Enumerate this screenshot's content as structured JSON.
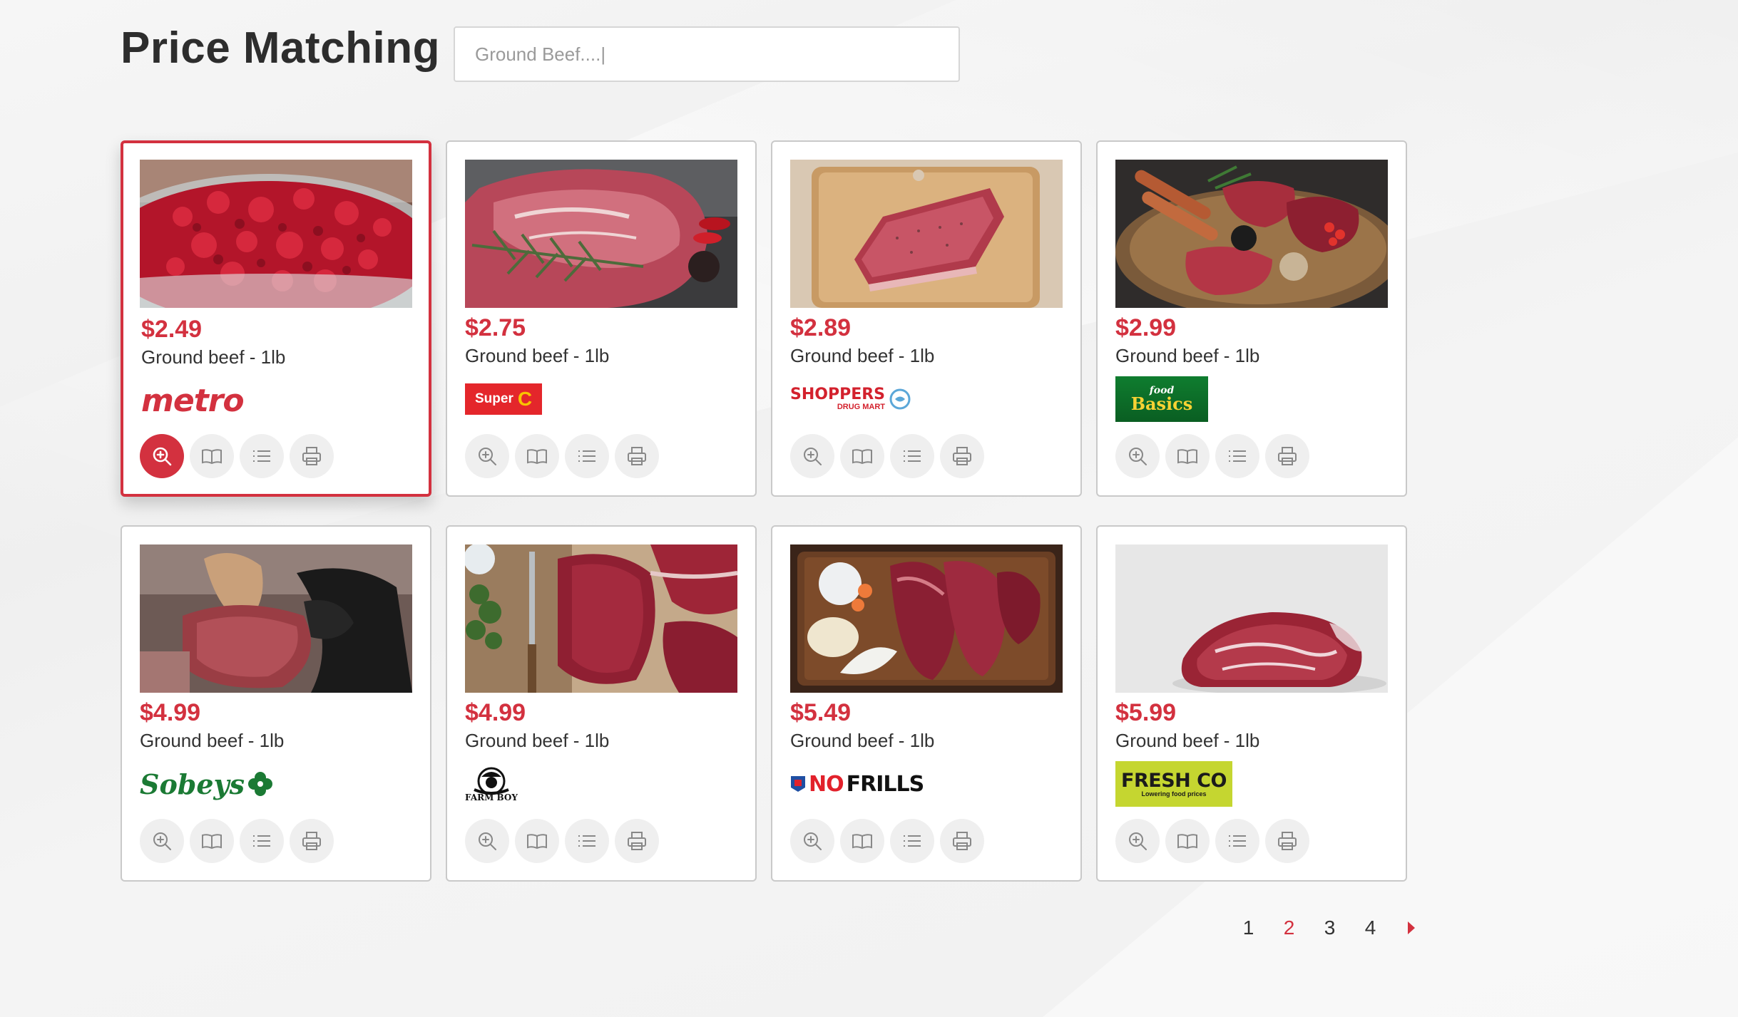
{
  "header": {
    "title": "Price Matching",
    "search_placeholder": "Ground Beef....|"
  },
  "products": [
    {
      "price": "$2.49",
      "name": "Ground beef - 1lb",
      "store": "metro",
      "logo_text": "metro"
    },
    {
      "price": "$2.75",
      "name": "Ground beef - 1lb",
      "store": "super-c",
      "logo_text": "Super"
    },
    {
      "price": "$2.89",
      "name": "Ground beef - 1lb",
      "store": "shoppers-drug-mart",
      "logo_text": "SHOPPERS",
      "logo_sub": "DRUG MART"
    },
    {
      "price": "$2.99",
      "name": "Ground beef - 1lb",
      "store": "food-basics",
      "logo_text": "food",
      "logo_sub": "Basics"
    },
    {
      "price": "$4.99",
      "name": "Ground beef - 1lb",
      "store": "sobeys",
      "logo_text": "Sobeys"
    },
    {
      "price": "$4.99",
      "name": "Ground beef - 1lb",
      "store": "farm-boy",
      "logo_text": "FARM BOY"
    },
    {
      "price": "$5.49",
      "name": "Ground beef - 1lb",
      "store": "no-frills",
      "logo_text": "NO",
      "logo_sub": "FRILLS"
    },
    {
      "price": "$5.99",
      "name": "Ground beef - 1lb",
      "store": "freshco",
      "logo_text": "FRESH CO",
      "logo_sub": "Lowering food prices"
    }
  ],
  "selected_index": 0,
  "actions": [
    "zoom-in-icon",
    "book-icon",
    "list-icon",
    "print-icon"
  ],
  "pagination": {
    "pages": [
      "1",
      "2",
      "3",
      "4"
    ],
    "current": "2"
  },
  "colors": {
    "accent": "#d3313f",
    "card_border": "#c9c9c9",
    "action_bg": "#efefef"
  }
}
